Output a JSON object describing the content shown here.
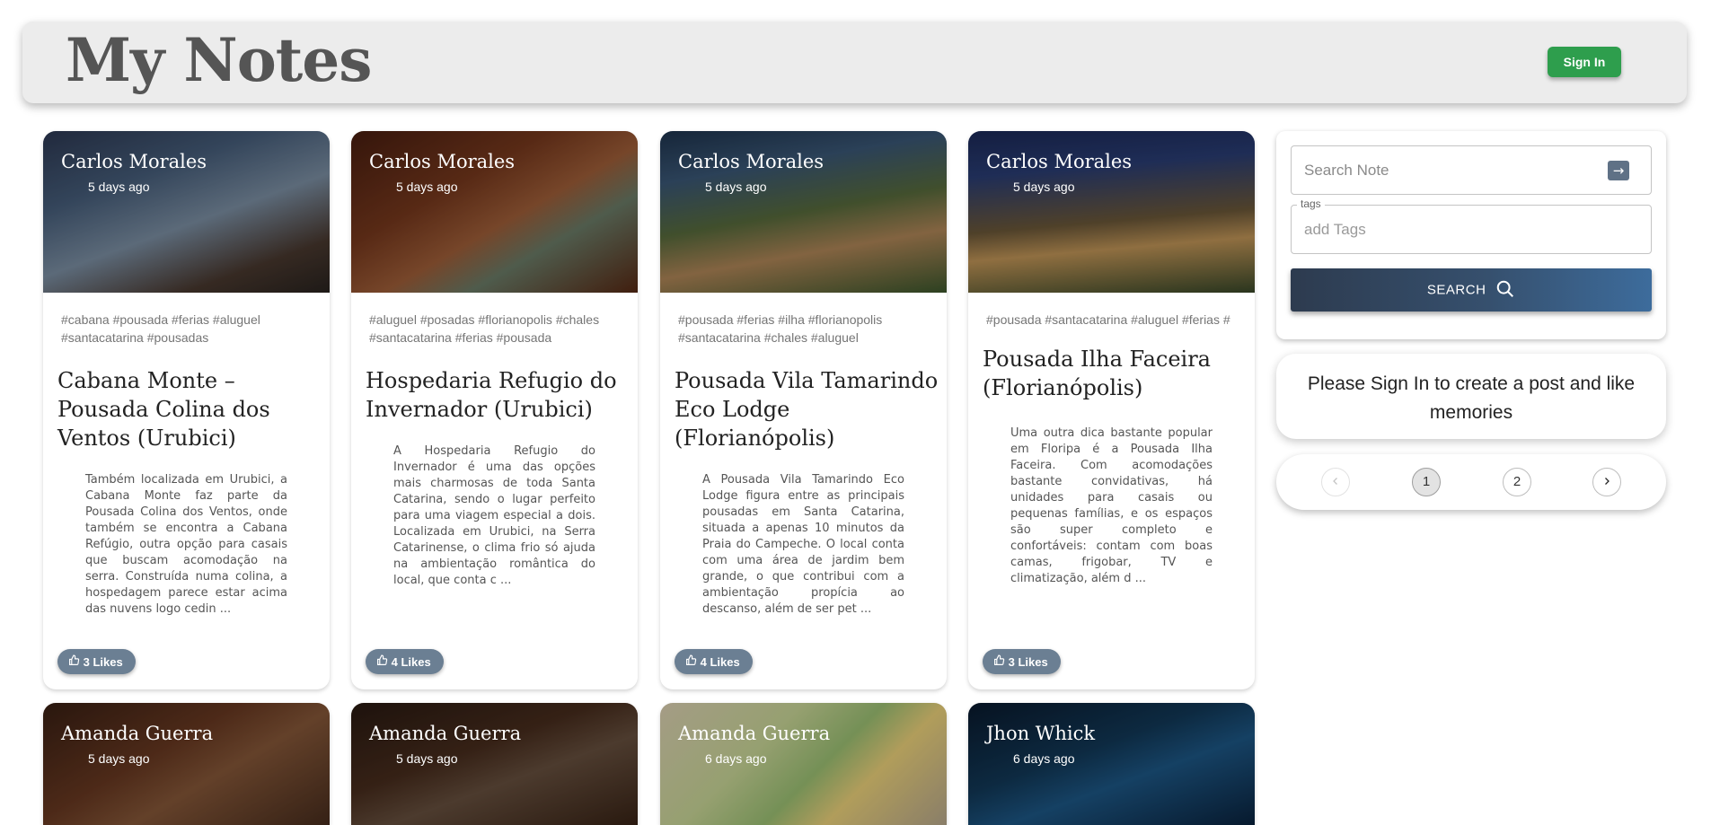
{
  "appbar": {
    "title": "My Notes",
    "signin_label": "Sign In"
  },
  "cards": [
    {
      "author": "Carlos Morales",
      "time": "5 days ago",
      "tags": "#cabana #pousada #ferias #aluguel #santacatarina #pousadas",
      "title": "Cabana Monte – Pousada Colina dos Ventos (Urubici)",
      "message": "Também localizada em Urubici, a Cabana Monte faz parte da Pousada Colina dos Ventos, onde também se encontra a Cabana Refúgio, outra opção para casais que buscam acomodação na serra. Construída numa colina, a hospedagem parece estar acima das nuvens logo cedin ...",
      "likes": "3 Likes"
    },
    {
      "author": "Carlos Morales",
      "time": "5 days ago",
      "tags": "#aluguel #posadas #florianopolis #chales #santacatarina #ferias #pousada",
      "title": "Hospedaria Refugio do Invernador (Urubici)",
      "message": "A Hospedaria Refugio do Invernador é uma das opções mais charmosas de toda Santa Catarina, sendo o lugar perfeito para uma viagem especial a dois. Localizada em Urubici, na Serra Catarinense, o clima frio só ajuda na ambientação romântica do local, que conta c ...",
      "likes": "4 Likes"
    },
    {
      "author": "Carlos Morales",
      "time": "5 days ago",
      "tags": "#pousada #ferias #ilha #florianopolis #santacatarina #chales #aluguel",
      "title": "Pousada Vila Tamarindo Eco Lodge (Florianópolis)",
      "message": "A Pousada Vila Tamarindo Eco Lodge figura entre as principais pousadas em Santa Catarina, situada a apenas 10 minutos da Praia do Campeche. O local conta com uma área de jardim bem grande, o que contribui com a ambientação propícia ao descanso, além de ser pet ...",
      "likes": "4 Likes"
    },
    {
      "author": "Carlos Morales",
      "time": "5 days ago",
      "tags": "#pousada #santacatarina #aluguel #ferias #",
      "title": "Pousada Ilha Faceira (Florianópolis)",
      "message": "Uma outra dica bastante popular em Floripa é a Pousada Ilha Faceira. Com acomodações bastante convidativas, há unidades para casais ou pequenas famílias, e os espaços são super completo e confortáveis: contam com boas camas, frigobar, TV e climatização, além d ...",
      "likes": "3 Likes"
    },
    {
      "author": "Amanda Guerra",
      "time": "5 days ago"
    },
    {
      "author": "Amanda Guerra",
      "time": "5 days ago"
    },
    {
      "author": "Amanda Guerra",
      "time": "6 days ago"
    },
    {
      "author": "Jhon Whick",
      "time": "6 days ago"
    }
  ],
  "form": {
    "search_placeholder": "Search Note",
    "tags_legend": "tags",
    "tags_placeholder": "add Tags",
    "search_button": "SEARCH"
  },
  "notice": {
    "text": "Please Sign In to create a post and like memories"
  },
  "pagination": {
    "pages": [
      "1",
      "2"
    ],
    "current": "1"
  },
  "colors": {
    "signin": "#2e9e4d",
    "likes": "#6b7f93",
    "appbar": "#ececec"
  }
}
